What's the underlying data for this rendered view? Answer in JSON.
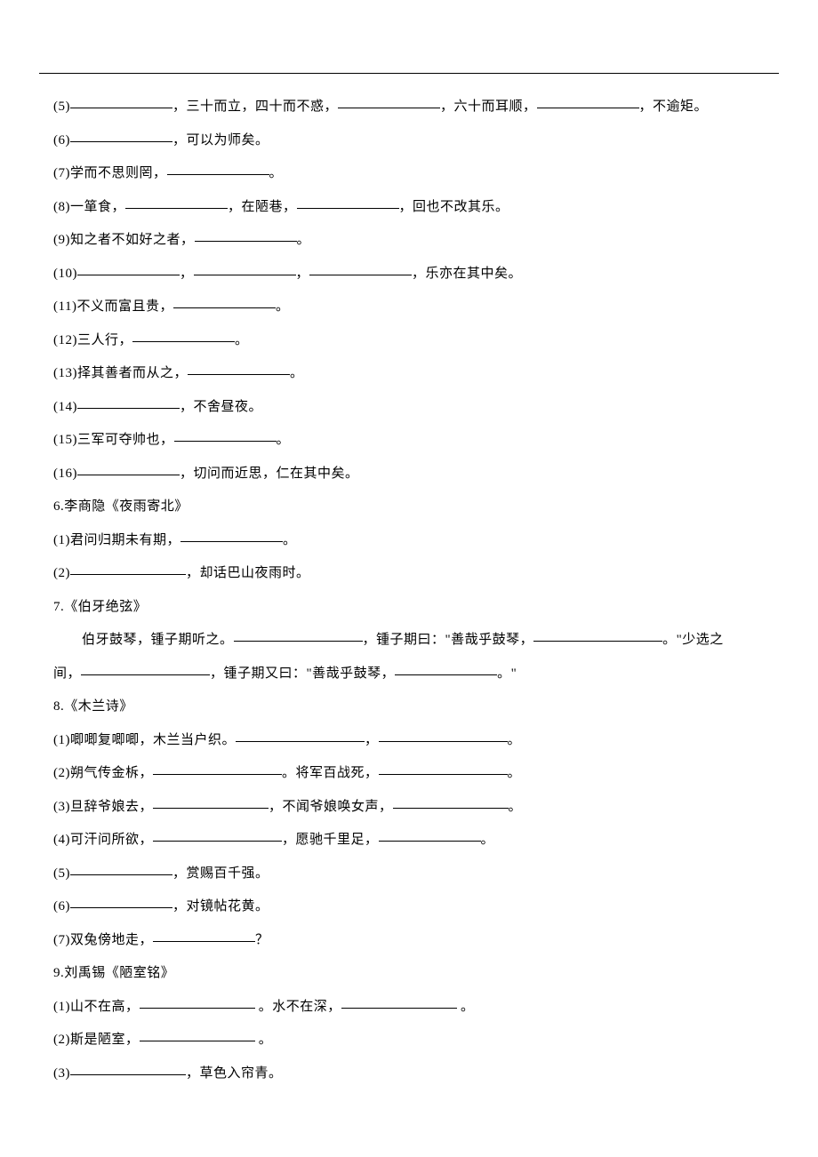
{
  "lines": {
    "l5": {
      "num": "(5)",
      "t1": "，三十而立，四十而不惑，",
      "t2": "，六十而耳顺，",
      "t3": "，不逾矩。"
    },
    "l6": {
      "num": "(6)",
      "t1": "，可以为师矣。"
    },
    "l7": {
      "num": "(7)",
      "pre": "学而不思则罔，",
      "t1": "。"
    },
    "l8": {
      "num": "(8)",
      "pre": "一箪食，",
      "t1": "，在陋巷，",
      "t2": "，回也不改其乐。"
    },
    "l9": {
      "num": "(9)",
      "pre": "知之者不如好之者，",
      "t1": "。"
    },
    "l10": {
      "num": "(10)",
      "t1": "，",
      "t2": "，",
      "t3": "，乐亦在其中矣。"
    },
    "l11": {
      "num": "(11)",
      "pre": "不义而富且贵，",
      "t1": "。"
    },
    "l12": {
      "num": "(12)",
      "pre": "三人行，",
      "t1": "。"
    },
    "l13": {
      "num": "(13)",
      "pre": "择其善者而从之，",
      "t1": "。"
    },
    "l14": {
      "num": "(14)",
      "t1": "，不舍昼夜。"
    },
    "l15": {
      "num": "(15)",
      "pre": "三军可夺帅也，",
      "t1": "。"
    },
    "l16": {
      "num": "(16)",
      "t1": "，切问而近思，仁在其中矣。"
    },
    "h6": "6.李商隐《夜雨寄北》",
    "h6_1": {
      "num": "(1)",
      "pre": "君问归期未有期，",
      "t1": "。"
    },
    "h6_2": {
      "num": "(2)",
      "t1": "，却话巴山夜雨时。"
    },
    "h7": "7.《伯牙绝弦》",
    "h7_1a": {
      "indent": "伯牙鼓琴，锺子期听之。",
      "t1": "，锺子期曰：\"善哉乎鼓琴，",
      "t2": "。\"少选之"
    },
    "h7_1b": {
      "pre": "间，",
      "t1": "，锺子期又曰：\"善哉乎鼓琴，",
      "t2": "。\""
    },
    "h8": "8.《木兰诗》",
    "h8_1": {
      "num": "(1)",
      "pre": "唧唧复唧唧，木兰当户织。",
      "t1": "，",
      "t2": "。"
    },
    "h8_2": {
      "num": "(2)",
      "pre": "朔气传金柝，",
      "t1": "。将军百战死，",
      "t2": "。"
    },
    "h8_3": {
      "num": "(3)",
      "pre": "旦辞爷娘去，",
      "t1": "，不闻爷娘唤女声，",
      "t2": "。"
    },
    "h8_4": {
      "num": "(4)",
      "pre": "可汗问所欲，",
      "t1": "，愿驰千里足，",
      "t2": "。"
    },
    "h8_5": {
      "num": "(5)",
      "t1": "，赏赐百千强。"
    },
    "h8_6": {
      "num": "(6)",
      "t1": "，对镜帖花黄。"
    },
    "h8_7": {
      "num": "(7)",
      "pre": "双兔傍地走，",
      "t1": "？"
    },
    "h9": "9.刘禹锡《陋室铭》",
    "h9_1": {
      "num": "(1)",
      "pre": "山不在高，",
      "t1": " 。水不在深，",
      "t2": " 。"
    },
    "h9_2": {
      "num": "(2)",
      "pre": "斯是陋室，",
      "t1": " 。"
    },
    "h9_3": {
      "num": "(3)",
      "t1": "，草色入帘青。"
    }
  }
}
